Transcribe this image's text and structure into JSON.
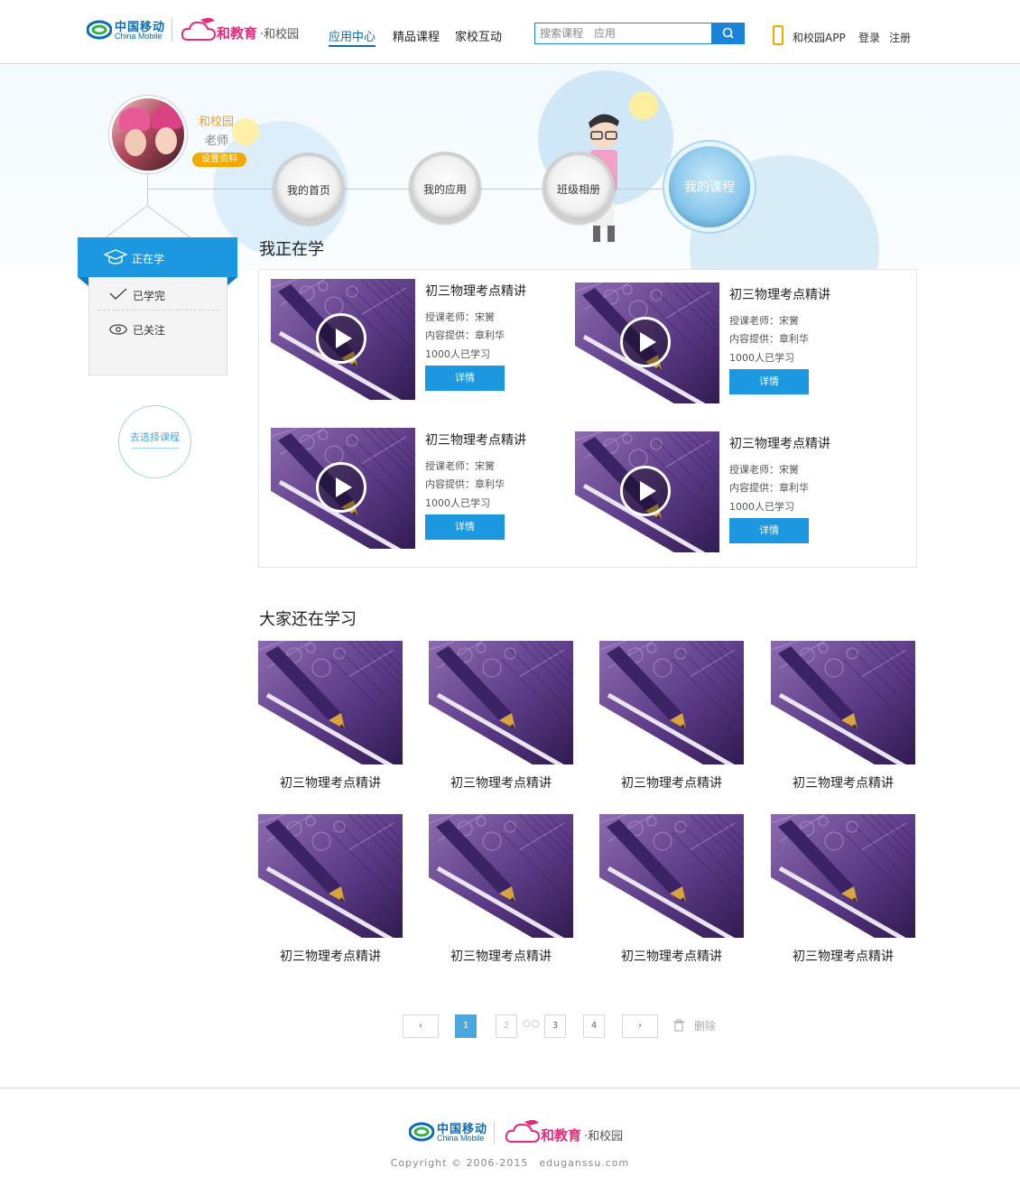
{
  "header": {
    "brand_cn": "中国移动",
    "brand_en": "China Mobile",
    "product_main": "和教育",
    "product_sub": "·和校园",
    "nav": [
      {
        "label": "应用中心",
        "active": true
      },
      {
        "label": "精品课程",
        "active": false
      },
      {
        "label": "家校互动",
        "active": false
      }
    ],
    "search_placeholder": "搜索课程　应用",
    "app_label": "和校园APP",
    "login": "登录",
    "register": "注册"
  },
  "profile": {
    "name": "和校园",
    "role": "老师",
    "settings": "设置资料"
  },
  "circle_nav": [
    {
      "label": "我的首页",
      "active": false
    },
    {
      "label": "我的应用",
      "active": false
    },
    {
      "label": "班级相册",
      "active": false
    },
    {
      "label": "我的课程",
      "active": true
    }
  ],
  "side_menu": {
    "active": "正在学",
    "items": [
      "已学完",
      "已关注"
    ],
    "choose_course": "去选择课程"
  },
  "learning": {
    "title": "我正在学",
    "teacher_prefix": "授课老师：",
    "provider_prefix": "内容提供：",
    "detail_label": "详情",
    "courses": [
      {
        "title": "初三物理考点精讲",
        "teacher": "宋黉",
        "provider": "章利华",
        "learners": "1000人已学习"
      },
      {
        "title": "初三物理考点精讲",
        "teacher": "宋黉",
        "provider": "章利华",
        "learners": "1000人已学习"
      },
      {
        "title": "初三物理考点精讲",
        "teacher": "宋黉",
        "provider": "章利华",
        "learners": "1000人已学习"
      },
      {
        "title": "初三物理考点精讲",
        "teacher": "宋黉",
        "provider": "章利华",
        "learners": "1000人已学习"
      }
    ]
  },
  "others": {
    "title": "大家还在学习",
    "items": [
      "初三物理考点精讲",
      "初三物理考点精讲",
      "初三物理考点精讲",
      "初三物理考点精讲",
      "初三物理考点精讲",
      "初三物理考点精讲",
      "初三物理考点精讲",
      "初三物理考点精讲"
    ]
  },
  "pager": {
    "prev": "‹",
    "next": "›",
    "pages": [
      "1",
      "2",
      "3",
      "4"
    ],
    "current": "1",
    "dots": "○○",
    "delete": "删除"
  },
  "footer": {
    "copyright": "Copyright © 2006-2015　eduganssu.com"
  },
  "colors": {
    "primary": "#1b98e0",
    "brand_blue": "#0a6ab5",
    "brand_pink": "#e6287a",
    "accent_orange": "#f2a900"
  }
}
